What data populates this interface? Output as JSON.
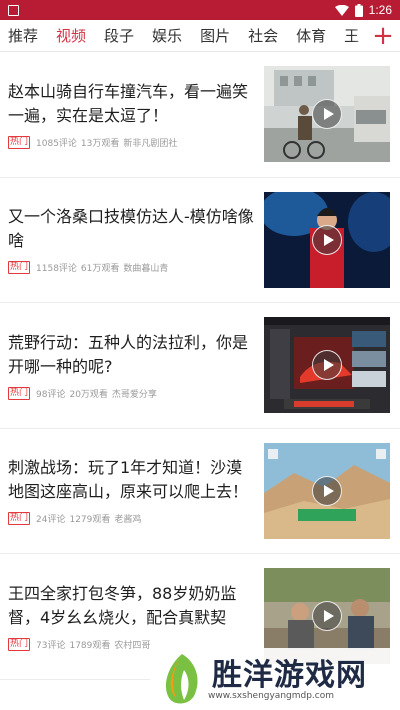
{
  "status_bar": {
    "time": "1:26"
  },
  "tabs": [
    "推荐",
    "视频",
    "段子",
    "娱乐",
    "图片",
    "社会",
    "体育",
    "王"
  ],
  "active_tab": "视频",
  "accent_color": "#d33245",
  "status_bar_color": "#b71c34",
  "add_icon": "plus-icon",
  "feed": [
    {
      "title": "赵本山骑自行车撞汽车，看一遍笑一遍，实在是太逗了！",
      "tag": "热门",
      "comments": "1085评论",
      "views": "13万观看",
      "author": "新非凡剧团社"
    },
    {
      "title": "又一个洛桑口技模仿达人-模仿啥像啥",
      "tag": "热门",
      "comments": "1158评论",
      "views": "61万观看",
      "author": "数曲暮山青"
    },
    {
      "title": "荒野行动：五种人的法拉利，你是开哪一种的呢?",
      "tag": "热门",
      "comments": "98评论",
      "views": "20万观看",
      "author": "杰哥爱分享"
    },
    {
      "title": "刺激战场：玩了1年才知道！沙漠地图这座高山，原来可以爬上去！",
      "tag": "热门",
      "comments": "24评论",
      "views": "1279观看",
      "author": "老酱鸡"
    },
    {
      "title": "王四全家打包冬笋，88岁奶奶监督，4岁幺幺烧火，配合真默契",
      "tag": "热门",
      "comments": "73评论",
      "views": "1789观看",
      "author": "农村四哥"
    }
  ],
  "watermark": {
    "title": "胜洋游戏网",
    "url": "www.sxshengyangmdp.com"
  }
}
